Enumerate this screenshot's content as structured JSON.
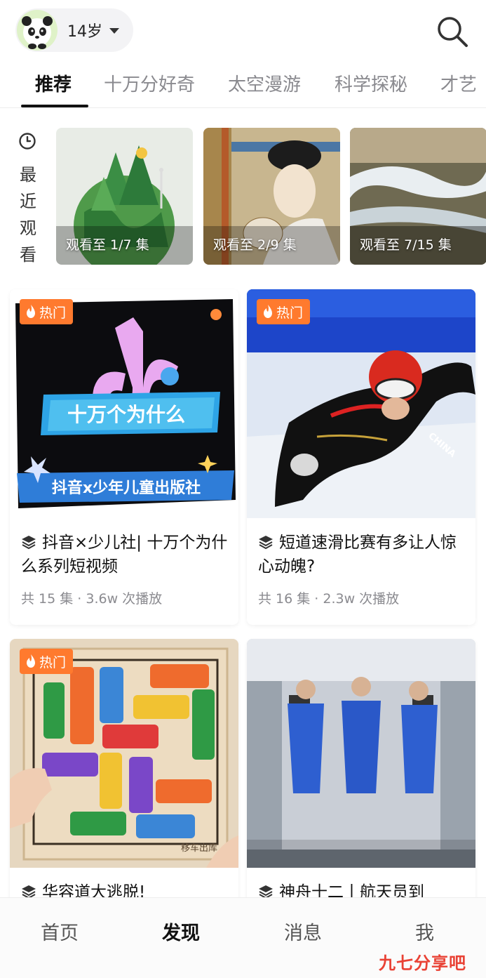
{
  "header": {
    "age_label": "14岁",
    "search_icon": "search-icon"
  },
  "tabs": [
    {
      "label": "推荐",
      "active": true
    },
    {
      "label": "十万分好奇",
      "active": false
    },
    {
      "label": "太空漫游",
      "active": false
    },
    {
      "label": "科学探秘",
      "active": false
    },
    {
      "label": "才艺",
      "active": false
    }
  ],
  "recent": {
    "label_chars": [
      "最",
      "近",
      "观",
      "看"
    ],
    "items": [
      {
        "progress": "观看至 1/7 集",
        "thumbnail": "green-earth-wind-turbines"
      },
      {
        "progress": "观看至 2/9 集",
        "thumbnail": "ancient-chinese-painting-lady"
      },
      {
        "progress": "观看至 7/15 集",
        "thumbnail": "river-landscape"
      }
    ]
  },
  "feed": [
    {
      "badge": "热门",
      "title": "抖音×少儿社| 十万个为什么系列短视频",
      "meta": "共 15 集 · 3.6w 次播放",
      "thumbnail": "douyin-100000-whys-poster",
      "poster_text_1": "十万个为什么",
      "poster_text_2": "抖音x少年儿童出版社"
    },
    {
      "badge": "热门",
      "title": "短道速滑比赛有多让人惊心动魄?",
      "meta": "共 16 集 · 2.3w 次播放",
      "thumbnail": "short-track-speed-skater",
      "poster_text_1": "CHINA"
    },
    {
      "badge": "热门",
      "title": "华容道大逃脱!",
      "thumbnail": "car-sliding-puzzle",
      "poster_text_1": "移车出库"
    },
    {
      "badge": "",
      "title": "神舟十二丨航天员到",
      "thumbnail": "astronauts-in-space-station"
    }
  ],
  "bottom_nav": [
    {
      "label": "首页",
      "active": false
    },
    {
      "label": "发现",
      "active": true
    },
    {
      "label": "消息",
      "active": false
    },
    {
      "label": "我",
      "active": false
    }
  ],
  "watermark": "九七分享吧",
  "colors": {
    "hot_badge": "#ff7a2e",
    "text_primary": "#111111",
    "text_secondary": "#8a8a8f",
    "watermark": "#e94235"
  }
}
